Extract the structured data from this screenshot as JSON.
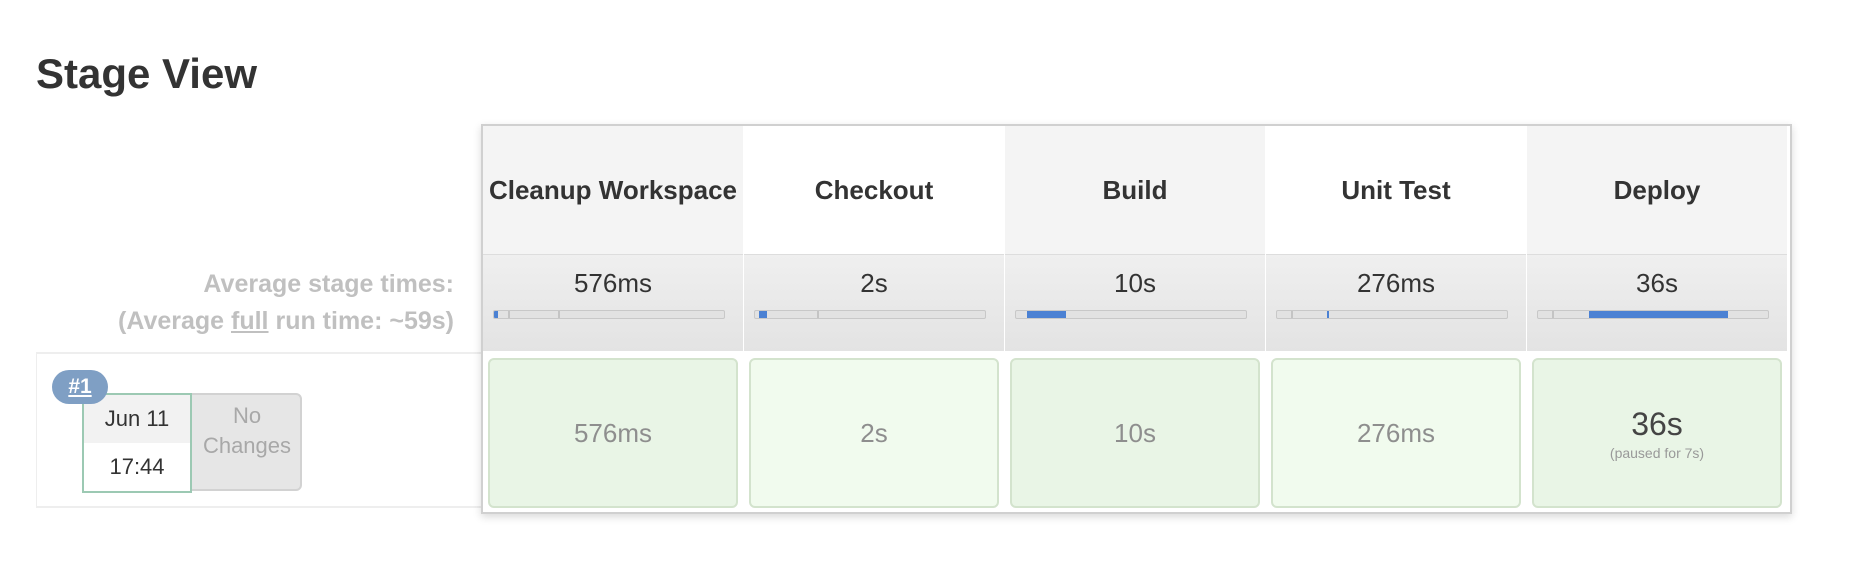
{
  "page_title": "Stage View",
  "average": {
    "label": "Average stage times:",
    "full_prefix": "(Average ",
    "full_word": "full",
    "full_suffix": " run time: ~59s)"
  },
  "stages": [
    {
      "name": "Cleanup Workspace",
      "avg": "576ms",
      "cell": "576ms",
      "bar_fraction": 0.016
    },
    {
      "name": "Checkout",
      "avg": "2s",
      "cell": "2s",
      "bar_fraction": 0.034
    },
    {
      "name": "Build",
      "avg": "10s",
      "cell": "10s",
      "bar_fraction": 0.169
    },
    {
      "name": "Unit Test",
      "avg": "276ms",
      "cell": "276ms",
      "bar_fraction": 0.005
    },
    {
      "name": "Deploy",
      "avg": "36s",
      "cell": "36s",
      "cell_note": "(paused for 7s)",
      "bar_fraction": 0.61
    }
  ],
  "build": {
    "number": "#1",
    "date": "Jun 11",
    "time": "17:44",
    "changes": "No Changes"
  },
  "colors": {
    "success_cell": "#e9f5e6",
    "progress_fill": "#4b81d3",
    "badge": "#7f9fc4"
  }
}
